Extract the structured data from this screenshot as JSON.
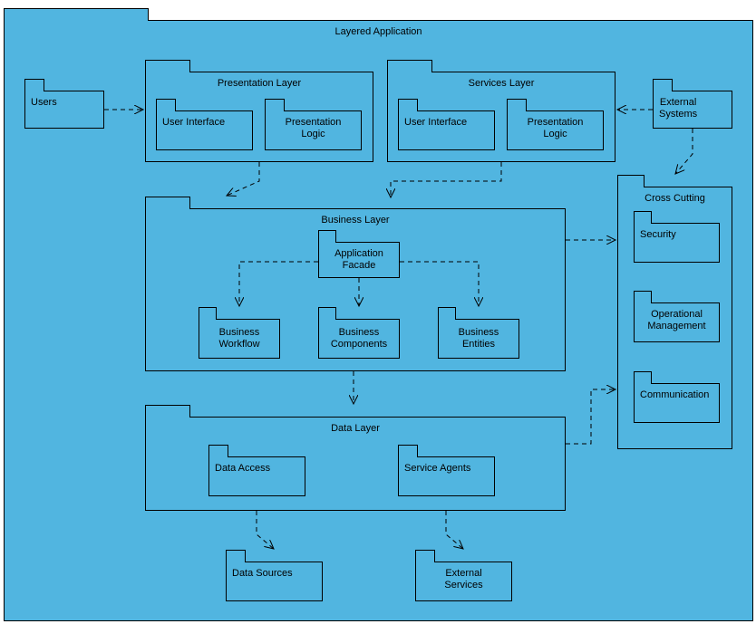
{
  "packages": {
    "layered_app": "Layered Application",
    "users": "Users",
    "presentation_layer": "Presentation Layer",
    "ui1": "User Interface",
    "pl1": "Presentation\nLogic",
    "services_layer": "Services Layer",
    "ui2": "User Interface",
    "pl2": "Presentation\nLogic",
    "external_systems": "External\nSystems",
    "business_layer": "Business Layer",
    "app_facade": "Application\nFacade",
    "bus_workflow": "Business\nWorkflow",
    "bus_components": "Business\nComponents",
    "bus_entities": "Business\nEntities",
    "cross_cutting": "Cross Cutting",
    "security": "Security",
    "op_mgmt": "Operational\nManagement",
    "communication": "Communication",
    "data_layer": "Data Layer",
    "data_access": "Data Access",
    "service_agents": "Service Agents",
    "data_sources": "Data Sources",
    "external_services": "External\nServices"
  }
}
